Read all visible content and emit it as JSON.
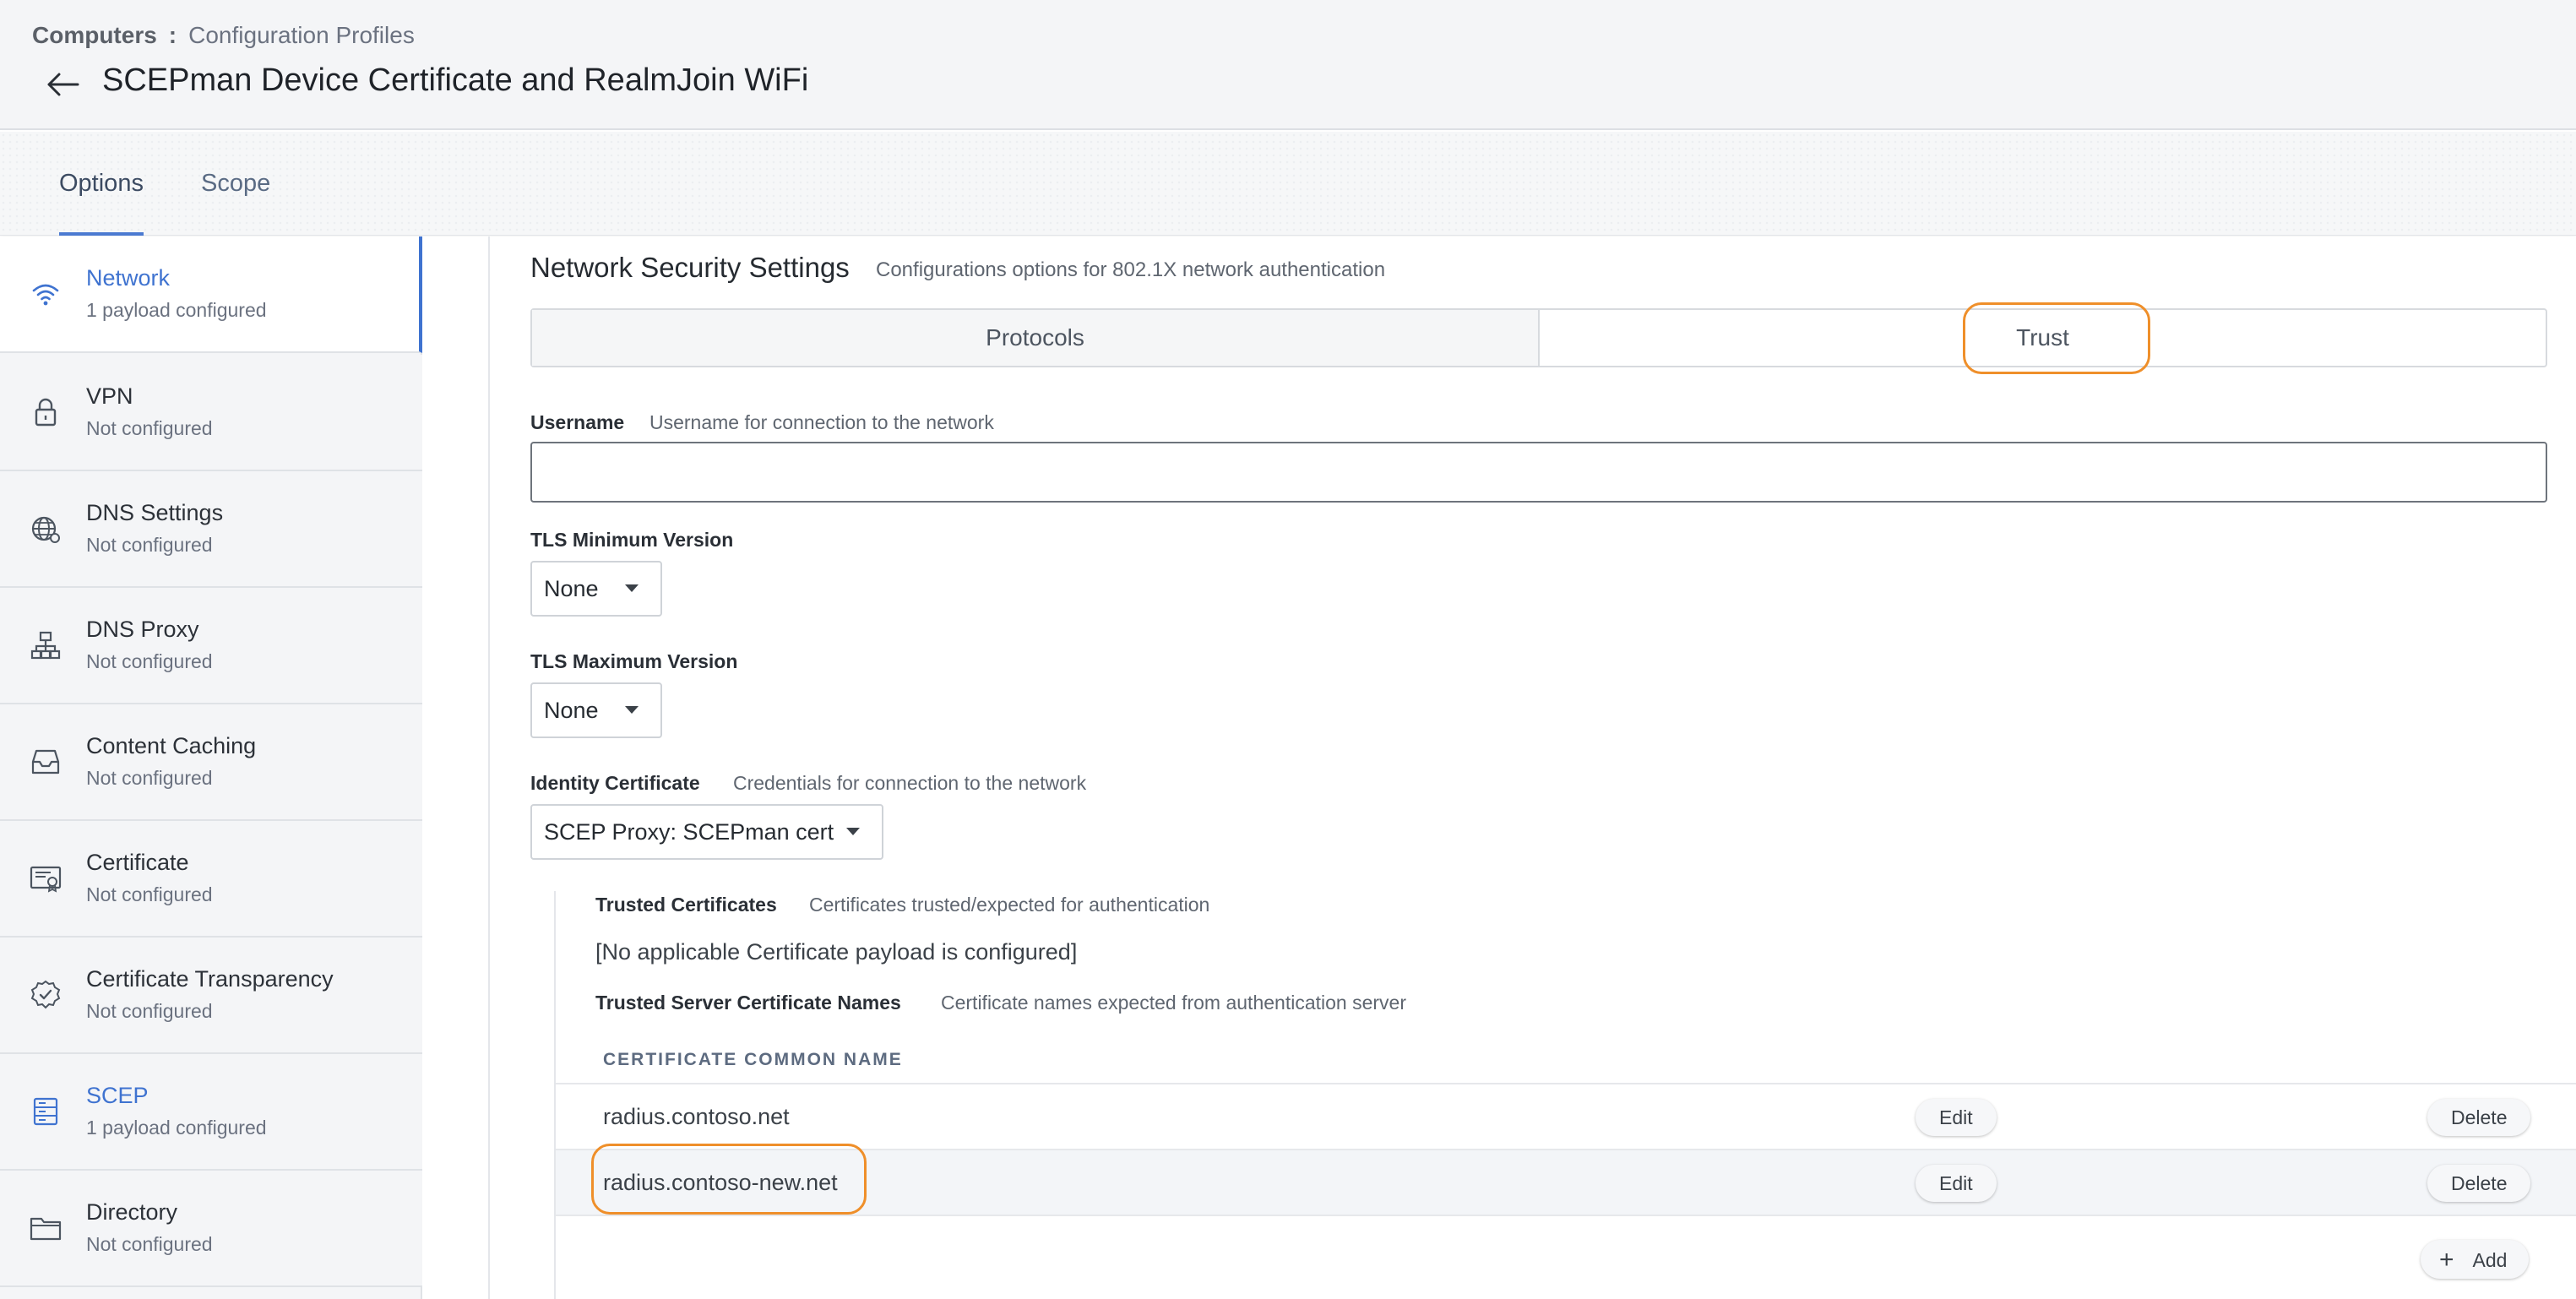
{
  "breadcrumb": {
    "root": "Computers",
    "separator": ":",
    "current": "Configuration Profiles"
  },
  "page": {
    "title": "SCEPman Device Certificate and RealmJoin WiFi"
  },
  "tabs": [
    {
      "label": "Options",
      "active": true
    },
    {
      "label": "Scope",
      "active": false
    }
  ],
  "sidebar": {
    "items": [
      {
        "label": "Network",
        "status": "1 payload configured",
        "icon": "wifi-icon"
      },
      {
        "label": "VPN",
        "status": "Not configured",
        "icon": "lock-icon"
      },
      {
        "label": "DNS Settings",
        "status": "Not configured",
        "icon": "globe-icon"
      },
      {
        "label": "DNS Proxy",
        "status": "Not configured",
        "icon": "hierarchy-icon"
      },
      {
        "label": "Content Caching",
        "status": "Not configured",
        "icon": "tray-icon"
      },
      {
        "label": "Certificate",
        "status": "Not configured",
        "icon": "certificate-icon"
      },
      {
        "label": "Certificate Transparency",
        "status": "Not configured",
        "icon": "verified-badge-icon"
      },
      {
        "label": "SCEP",
        "status": "1 payload configured",
        "icon": "server-icon"
      },
      {
        "label": "Directory",
        "status": "Not configured",
        "icon": "folder-icon"
      }
    ]
  },
  "section": {
    "title": "Network Security Settings",
    "description": "Configurations options for 802.1X network authentication"
  },
  "segment": {
    "protocols": "Protocols",
    "trust": "Trust"
  },
  "username": {
    "label": "Username",
    "hint": "Username for connection to the network",
    "value": ""
  },
  "tls_min": {
    "label": "TLS Minimum Version",
    "value": "None"
  },
  "tls_max": {
    "label": "TLS Maximum Version",
    "value": "None"
  },
  "identity": {
    "label": "Identity Certificate",
    "hint": "Credentials for connection to the network",
    "value": "SCEP Proxy: SCEPman cert"
  },
  "trusted": {
    "label": "Trusted Certificates",
    "hint": "Certificates trusted/expected for authentication",
    "empty_note": "[No applicable Certificate payload is configured]"
  },
  "server_names": {
    "label": "Trusted Server Certificate Names",
    "hint": "Certificate names expected from authentication server",
    "column_header": "CERTIFICATE COMMON NAME",
    "rows": [
      {
        "name": "radius.contoso.net",
        "edit": "Edit",
        "delete": "Delete"
      },
      {
        "name": "radius.contoso-new.net",
        "edit": "Edit",
        "delete": "Delete"
      }
    ],
    "add_label": "Add",
    "add_icon": "plus-icon"
  },
  "colors": {
    "accent": "#3f73d0",
    "highlight": "#ef8f2a"
  }
}
